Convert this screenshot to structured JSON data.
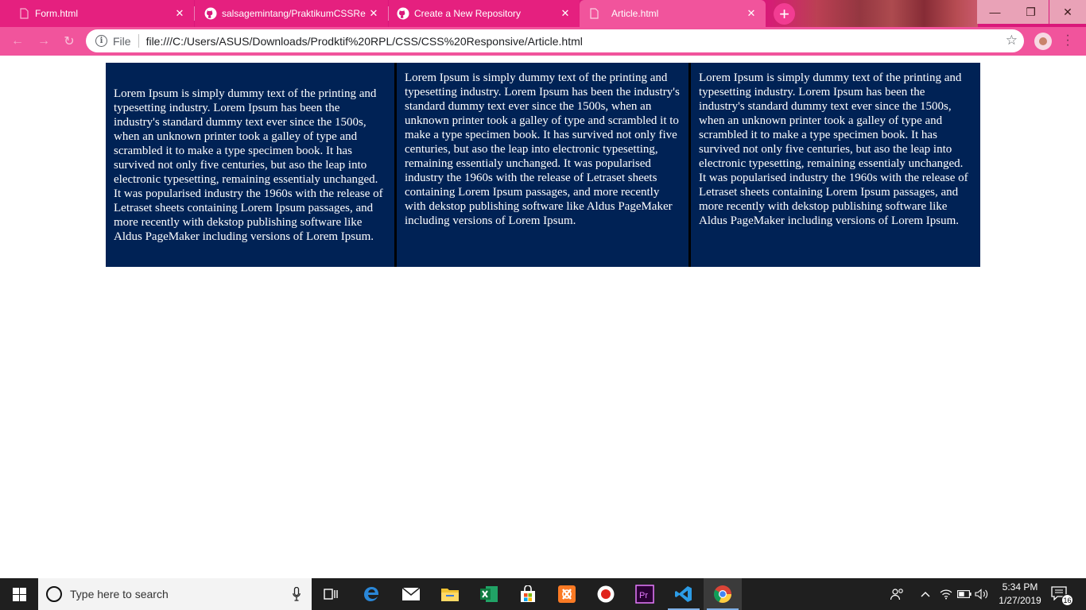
{
  "browser": {
    "tabs": [
      {
        "title": "Form.html",
        "icon": "file-icon",
        "active": false
      },
      {
        "title": "salsagemintang/PraktikumCSSRe",
        "icon": "github-icon",
        "active": false
      },
      {
        "title": "Create a New Repository",
        "icon": "github-icon",
        "active": false
      },
      {
        "title": "Article.html",
        "icon": "file-icon",
        "active": true
      }
    ],
    "new_tab_symbol": "+",
    "window_controls": {
      "minimize": "—",
      "restore": "❐",
      "close": "✕"
    },
    "address": {
      "scheme_label": "File",
      "url": "file:///C:/Users/ASUS/Downloads/Prodktif%20RPL/CSS/CSS%20Responsive/Article.html"
    },
    "accent_color": "#d9187a",
    "active_tab_color": "#f1549c"
  },
  "page": {
    "background_color": "#002255",
    "columns": [
      {
        "text": "Lorem Ipsum is simply dummy text of the printing and typesetting industry. Lorem Ipsum has been the industry's standard dummy text ever since the 1500s, when an unknown printer took a galley of type and scrambled it to make a type specimen book. It has survived not only five centuries, but aso the leap into electronic typesetting, remaining essentialy unchanged. It was popularised industry the 1960s with the release of Letraset sheets containing Lorem Ipsum passages, and more recently with dekstop publishing software like Aldus PageMaker including versions of Lorem Ipsum."
      },
      {
        "text": "Lorem Ipsum is simply dummy text of the printing and typesetting industry. Lorem Ipsum has been the industry's standard dummy text ever since the 1500s, when an unknown printer took a galley of type and scrambled it to make a type specimen book. It has survived not only five centuries, but aso the leap into electronic typesetting, remaining essentialy unchanged. It was popularised industry the 1960s with the release of Letraset sheets containing Lorem Ipsum passages, and more recently with dekstop publishing software like Aldus PageMaker including versions of Lorem Ipsum."
      },
      {
        "text": "Lorem Ipsum is simply dummy text of the printing and typesetting industry. Lorem Ipsum has been the industry's standard dummy text ever since the 1500s, when an unknown printer took a galley of type and scrambled it to make a type specimen book. It has survived not only five centuries, but aso the leap into electronic typesetting, remaining essentialy unchanged. It was popularised industry the 1960s with the release of Letraset sheets containing Lorem Ipsum passages, and more recently with dekstop publishing software like Aldus PageMaker including versions of Lorem Ipsum."
      }
    ]
  },
  "taskbar": {
    "search_placeholder": "Type here to search",
    "apps": [
      "task-view-icon",
      "edge-icon",
      "mail-icon",
      "file-explorer-icon",
      "excel-icon",
      "store-icon",
      "xampp-icon",
      "record-icon",
      "premiere-icon",
      "vscode-icon",
      "chrome-icon"
    ],
    "tray_icons": [
      "people-icon",
      "chevron-up-icon",
      "wifi-icon",
      "battery-icon",
      "volume-icon"
    ],
    "clock": {
      "time": "5:34 PM",
      "date": "1/27/2019"
    },
    "notification_count": "16"
  }
}
